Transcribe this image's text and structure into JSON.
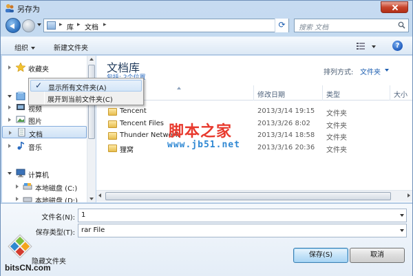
{
  "window": {
    "title": "另存为"
  },
  "address": {
    "crumbs": [
      "库",
      "文档"
    ],
    "search_placeholder": "搜索 文档"
  },
  "toolbar": {
    "organize_label": "组织",
    "new_folder_label": "新建文件夹"
  },
  "nav": {
    "items": [
      {
        "label": "收藏夹",
        "icon": "star-icon"
      },
      {
        "label": "库",
        "icon": "library-icon"
      },
      {
        "label": "视频",
        "icon": "video-icon"
      },
      {
        "label": "图片",
        "icon": "picture-icon"
      },
      {
        "label": "文档",
        "icon": "document-icon"
      },
      {
        "label": "音乐",
        "icon": "music-icon"
      },
      {
        "label": "计算机",
        "icon": "computer-icon"
      },
      {
        "label": "本地磁盘 (C:)",
        "icon": "drive-icon"
      },
      {
        "label": "本地磁盘 (D:)",
        "icon": "drive-icon"
      }
    ]
  },
  "context_menu": {
    "items": [
      {
        "label": "显示所有文件夹(A)",
        "checked": true
      },
      {
        "label": "展开到当前文件夹(C)",
        "checked": false
      }
    ]
  },
  "library": {
    "title": "文档库",
    "subtitle": "包括: 2个位置",
    "arrange_label": "排列方式:",
    "arrange_value": "文件夹"
  },
  "columns": {
    "name": "名称",
    "modified": "修改日期",
    "type": "类型",
    "size": "大小"
  },
  "files": [
    {
      "name": "Tencent",
      "modified": "2013/3/14 19:15",
      "type": "文件夹"
    },
    {
      "name": "Tencent Files",
      "modified": "2013/3/26 8:02",
      "type": "文件夹"
    },
    {
      "name": "Thunder Network",
      "modified": "2013/3/14 18:58",
      "type": "文件夹"
    },
    {
      "name": "狸窝",
      "modified": "2013/3/16 20:36",
      "type": "文件夹"
    }
  ],
  "form": {
    "filename_label": "文件名(N):",
    "filename_value": "1",
    "filetype_label": "保存类型(T):",
    "filetype_value": "rar File",
    "hide_folders_label": "隐藏文件夹",
    "save_label": "保存(S)",
    "cancel_label": "取消"
  },
  "watermark": {
    "main": "脚本之家",
    "url": "www.jb51.net",
    "bits": "bitsCN.com"
  }
}
